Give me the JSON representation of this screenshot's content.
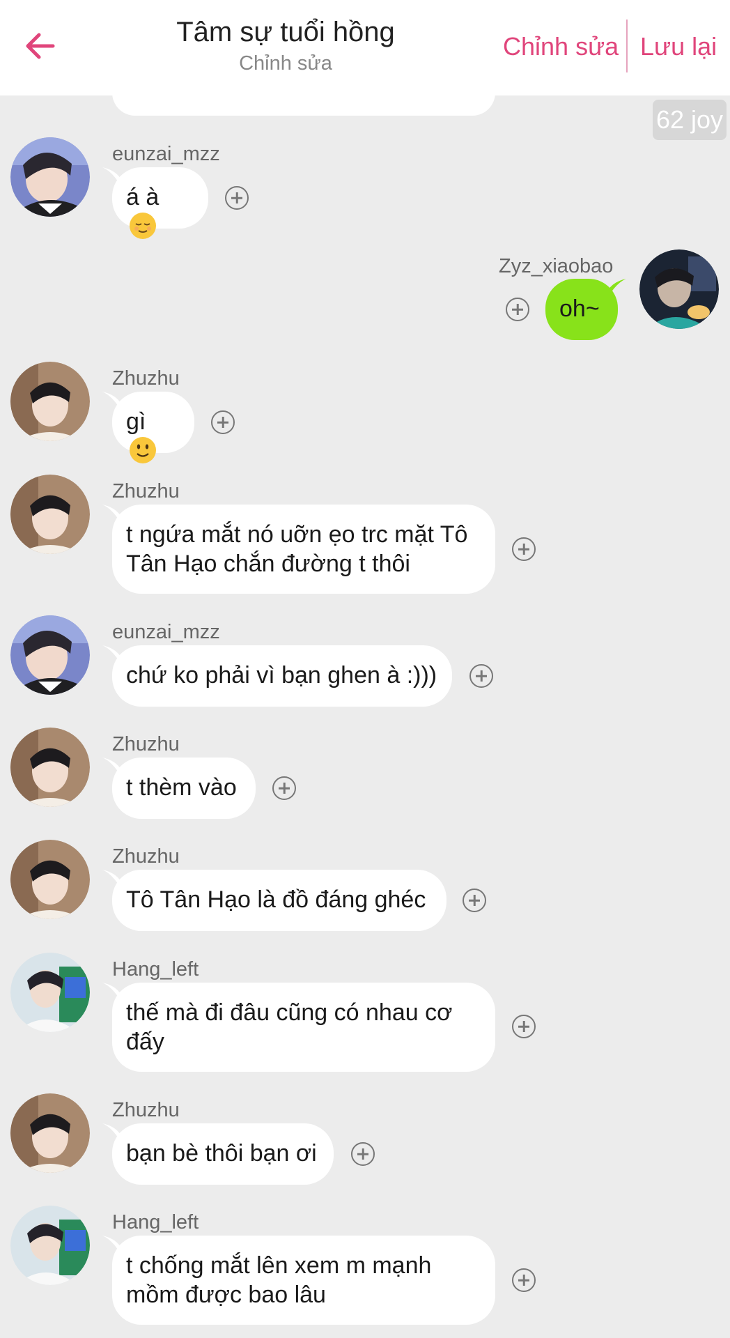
{
  "header": {
    "title": "Tâm sự tuổi hồng",
    "subtitle": "Chỉnh sửa",
    "edit_label": "Chỉnh sửa",
    "save_label": "Lưu lại",
    "back_icon": "arrow-left-icon",
    "accent_color": "#e0457b"
  },
  "badge": {
    "text": "62 joy"
  },
  "messages": [
    {
      "user": "eunzai_mzz",
      "text": "á à",
      "emoji": "relieved-face",
      "side": "left"
    },
    {
      "user": "Zyz_xiaobao",
      "text": "oh~",
      "side": "right"
    },
    {
      "user": "Zhuzhu",
      "text": "gì",
      "emoji": "slightly-smiling-face",
      "side": "left"
    },
    {
      "user": "Zhuzhu",
      "line1": "t ngứa mắt nó uỡn ẹo trc mặt Tô",
      "line2": "Tân Hạo chắn đường t thôi",
      "side": "left"
    },
    {
      "user": "eunzai_mzz",
      "text": "chứ ko phải vì bạn ghen à :)))",
      "side": "left"
    },
    {
      "user": "Zhuzhu",
      "text": "t thèm vào",
      "side": "left"
    },
    {
      "user": "Zhuzhu",
      "text": "Tô Tân Hạo là đồ đáng ghéc",
      "side": "left"
    },
    {
      "user": "Hang_left",
      "line1": "thế mà đi đâu cũng có nhau cơ",
      "line2": "đấy",
      "side": "left"
    },
    {
      "user": "Zhuzhu",
      "text": "bạn bè thôi bạn ơi",
      "side": "left"
    },
    {
      "user": "Hang_left",
      "line1": "t chống mắt lên xem m mạnh",
      "line2": "mồm được bao lâu",
      "side": "left"
    }
  ]
}
